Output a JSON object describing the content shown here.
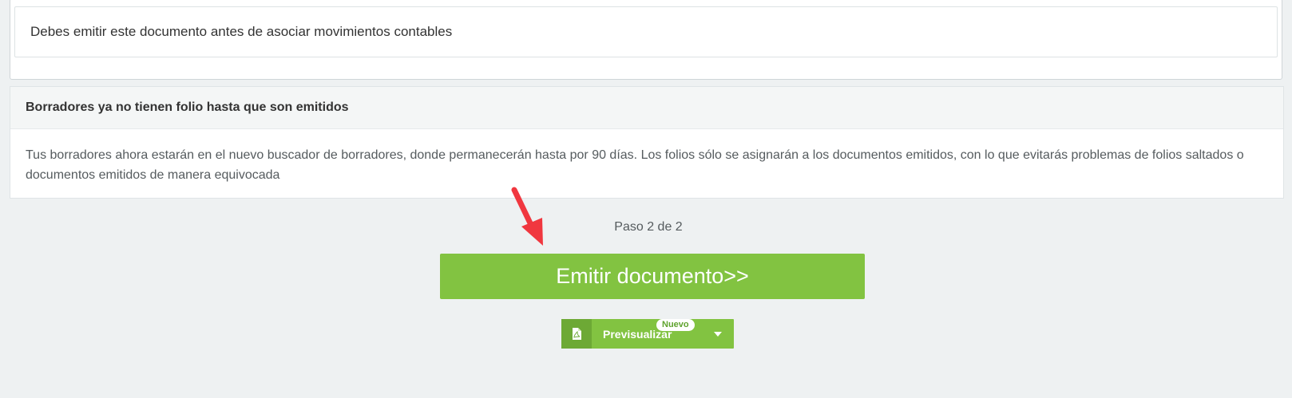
{
  "notice": {
    "message": "Debes emitir este documento antes de asociar movimientos contables"
  },
  "info_panel": {
    "title": "Borradores ya no tienen folio hasta que son emitidos",
    "body": "Tus borradores ahora estarán en el nuevo buscador de borradores, donde permanecerán hasta por 90 días. Los folios sólo se asignarán a los documentos emitidos, con lo que evitarás problemas de folios saltados o documentos emitidos de manera equivocada"
  },
  "step": {
    "label": "Paso 2 de 2"
  },
  "emit_button": {
    "label": "Emitir documento>>"
  },
  "preview": {
    "label": "Previsualizar",
    "badge": "Nuevo",
    "icon": "pdf-file-icon",
    "dropdown_icon": "caret-down-icon"
  },
  "annotation": {
    "icon": "red-arrow-pointer",
    "color": "#f0373f"
  },
  "colors": {
    "accent_green": "#82c341",
    "dark_green": "#6da935",
    "background": "#eef1f2"
  }
}
